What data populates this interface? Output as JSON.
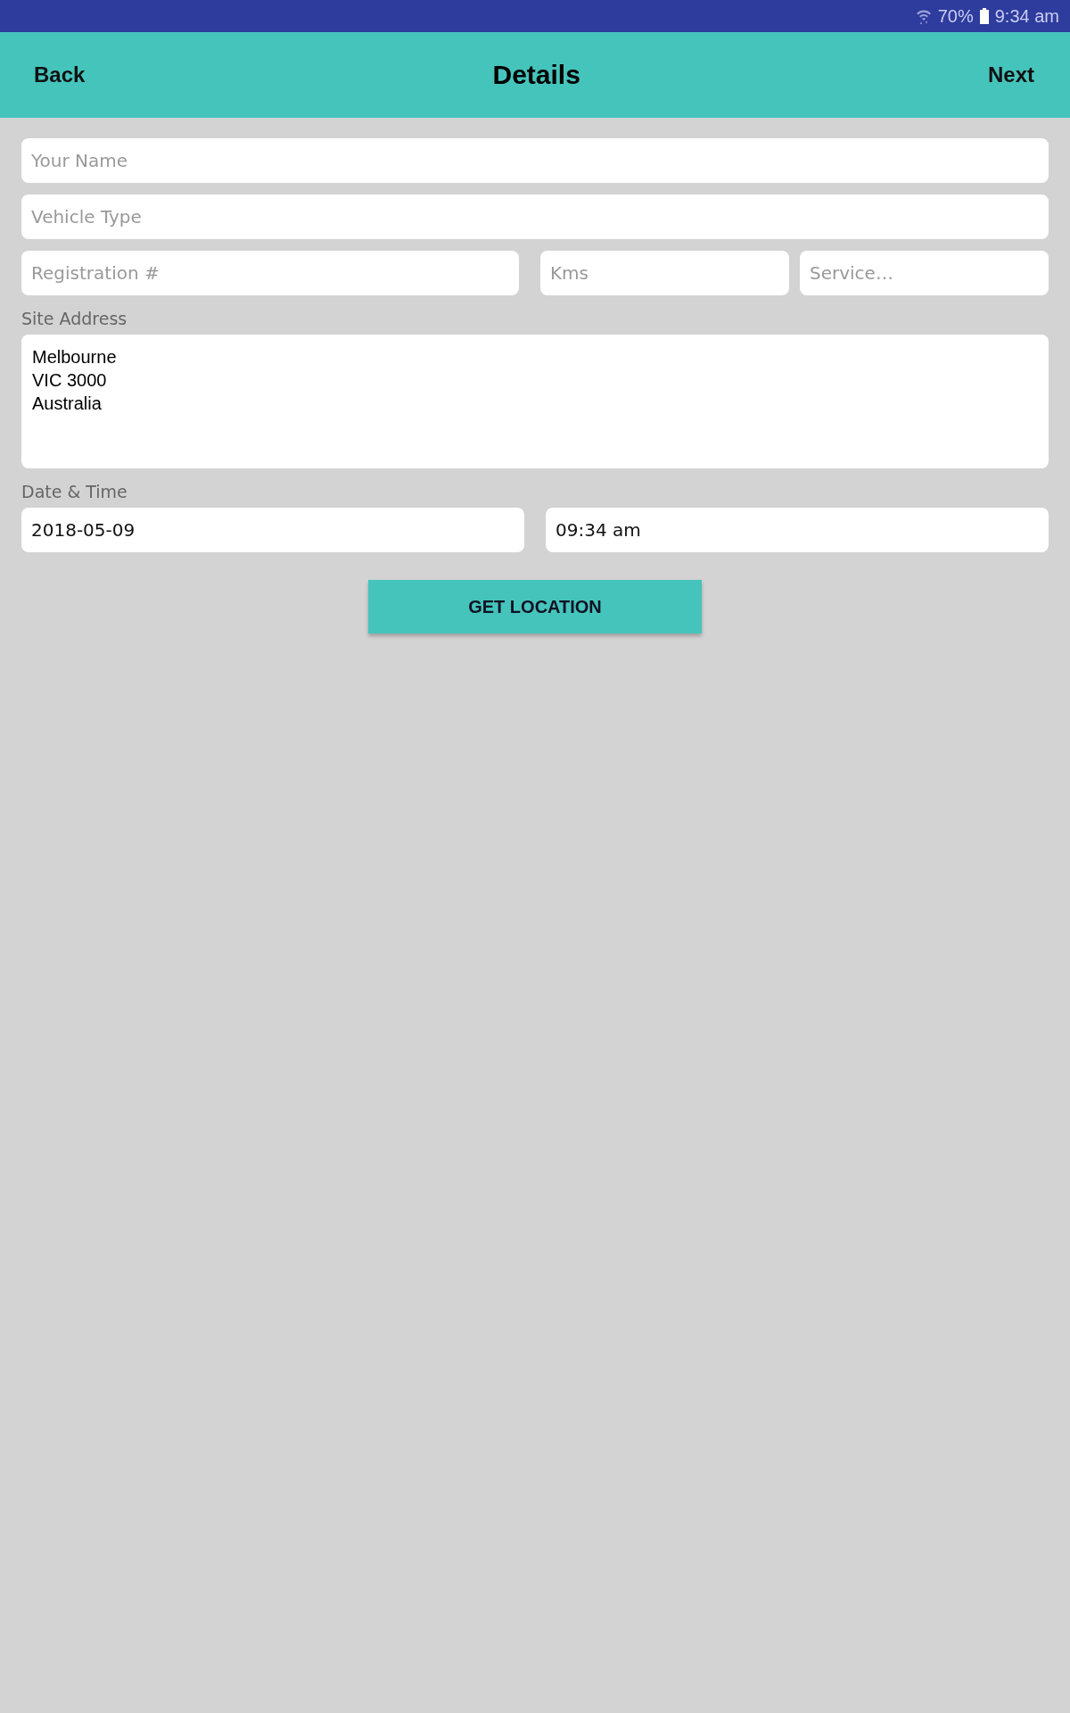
{
  "status_bar": {
    "battery": "70%",
    "time": "9:34 am"
  },
  "header": {
    "back": "Back",
    "title": "Details",
    "next": "Next"
  },
  "fields": [
    {
      "placeholder": "Your Name"
    },
    {
      "placeholder": "Vehicle Type"
    }
  ],
  "row_fields": [
    {
      "placeholder": "Registration #"
    },
    {
      "placeholder": "Kms"
    },
    {
      "placeholder": "Service…"
    }
  ],
  "site_address": {
    "label": "Site Address",
    "value": "Melbourne\nVIC 3000\nAustralia"
  },
  "date_time": {
    "label": "Date & Time",
    "date": "2018-05-09",
    "time": "09:34 am"
  },
  "button": "GET LOCATION"
}
